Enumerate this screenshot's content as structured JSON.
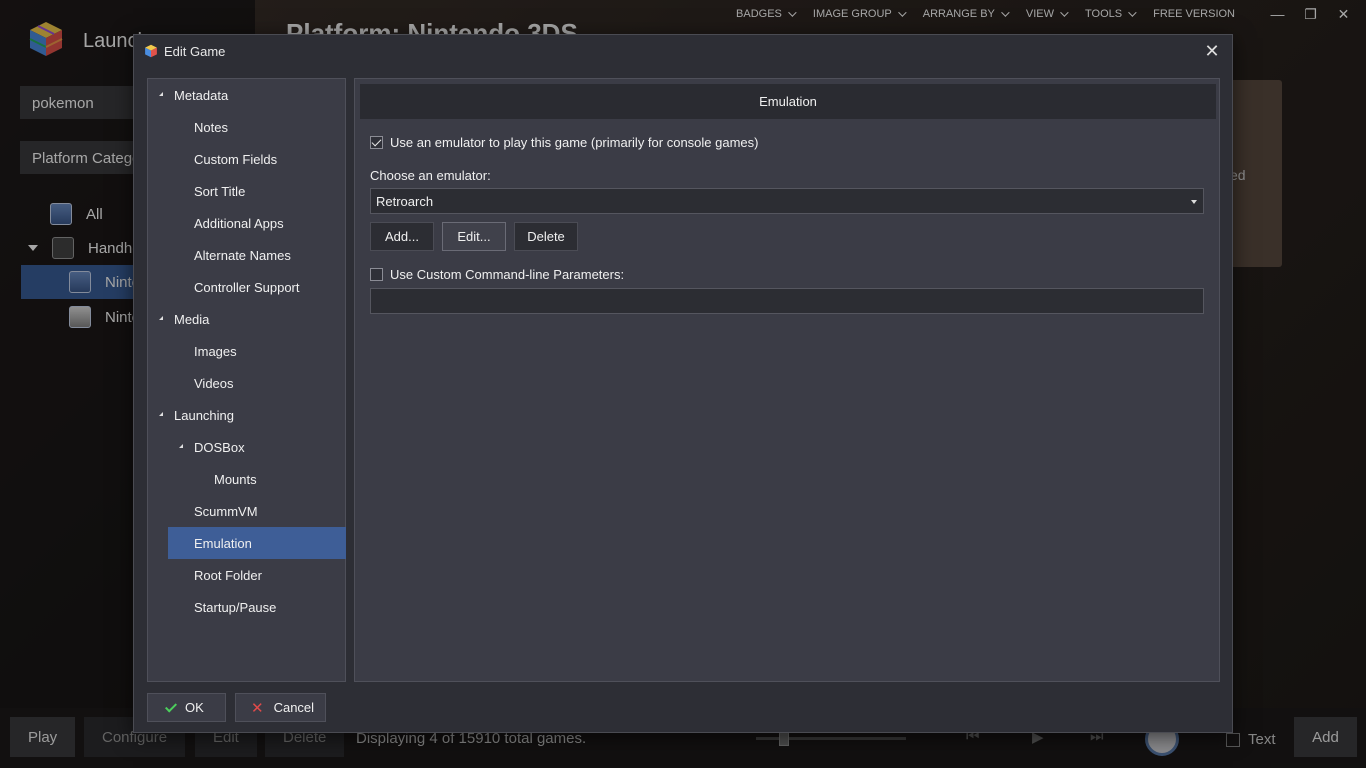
{
  "background_app": {
    "title": "Launch",
    "search_value": "pokemon",
    "category_value": "Platform Catego",
    "tree": [
      {
        "label": "All"
      },
      {
        "label": "Handhe"
      },
      {
        "label": "Ninte"
      },
      {
        "label": "Ninte"
      }
    ],
    "heading": "Platform: Nintendo 3DS",
    "card_text": "ed",
    "menubar": [
      "BADGES",
      "IMAGE GROUP",
      "ARRANGE BY",
      "VIEW",
      "TOOLS"
    ],
    "free_version": "FREE VERSION",
    "window_controls": {
      "minimize": "—",
      "restore": "❐",
      "close": "✕"
    },
    "footer": {
      "play": "Play",
      "configure": "Configure",
      "edit": "Edit",
      "delete": "Delete",
      "status": "Displaying 4 of 15910 total games.",
      "prev_icon": "⏮",
      "play_icon": "▶",
      "next_icon": "⏭",
      "text_toggle": "Text",
      "add": "Add"
    }
  },
  "dialog": {
    "title": "Edit Game",
    "close_icon": "✕",
    "nav": [
      {
        "label": "Metadata",
        "expander": true
      },
      {
        "label": "Notes"
      },
      {
        "label": "Custom Fields"
      },
      {
        "label": "Sort Title"
      },
      {
        "label": "Additional Apps"
      },
      {
        "label": "Alternate Names"
      },
      {
        "label": "Controller Support"
      },
      {
        "label": "Media",
        "expander": true
      },
      {
        "label": "Images"
      },
      {
        "label": "Videos"
      },
      {
        "label": "Launching",
        "expander": true
      },
      {
        "label": "DOSBox",
        "expander": true
      },
      {
        "label": "Mounts"
      },
      {
        "label": "ScummVM"
      },
      {
        "label": "Emulation",
        "selected": true
      },
      {
        "label": "Root Folder"
      },
      {
        "label": "Startup/Pause"
      }
    ],
    "section_header": "Emulation",
    "use_emulator": {
      "checked": true,
      "label": "Use an emulator to play this game (primarily for console games)"
    },
    "choose_label": "Choose an emulator:",
    "emulator_selected": "Retroarch",
    "buttons": {
      "add": "Add...",
      "edit": "Edit...",
      "delete": "Delete"
    },
    "custom_cmd": {
      "checked": false,
      "label": "Use Custom Command-line Parameters:"
    },
    "custom_cmd_value": "",
    "ok": "OK",
    "cancel": "Cancel"
  },
  "colors": {
    "accent_selected": "#3e5e97",
    "dialog_bg": "#2d2e35",
    "panel_bg": "#3b3c46",
    "ok_green": "#4ccf5c",
    "cancel_red": "#e04a4a"
  }
}
